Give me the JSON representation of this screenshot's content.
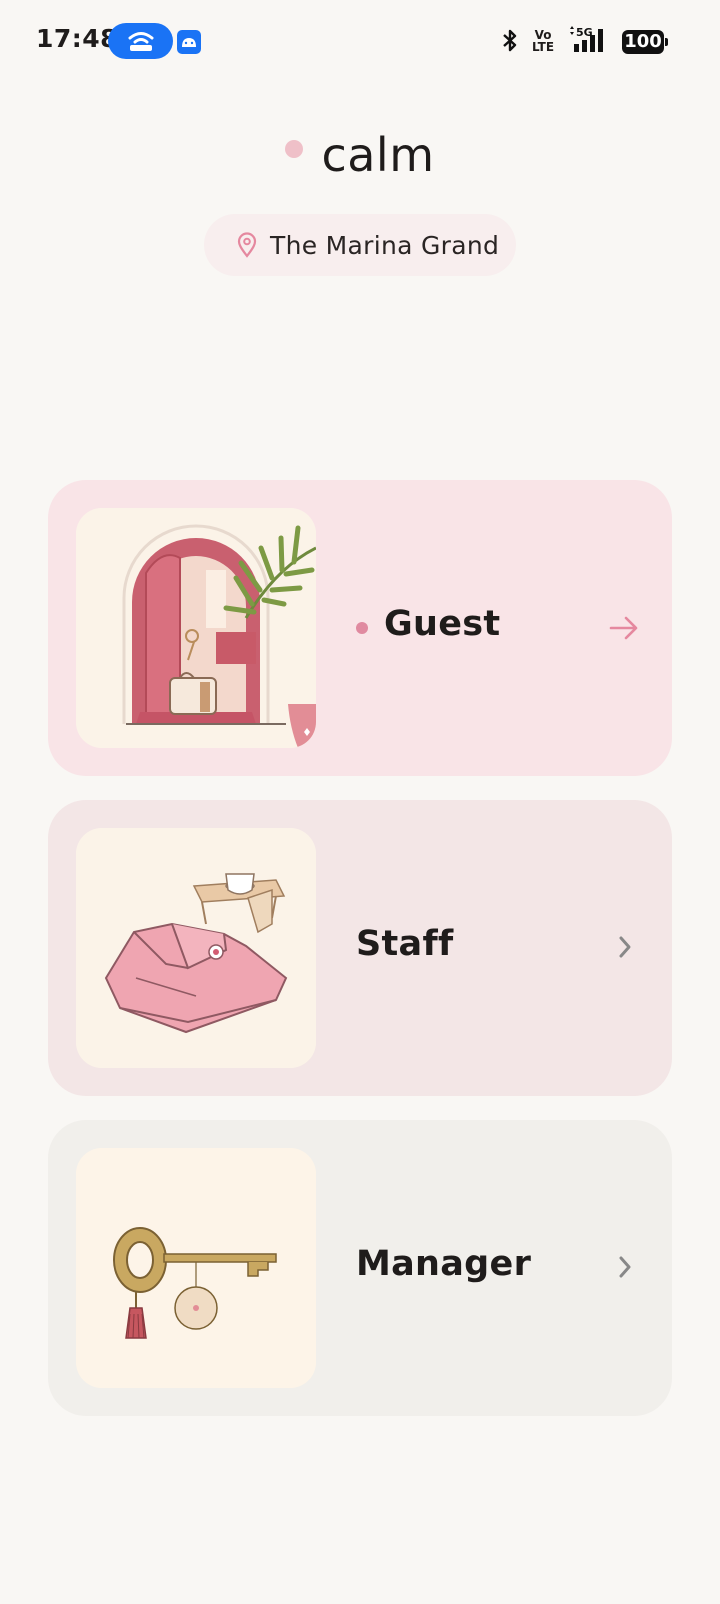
{
  "status_bar": {
    "time": "17:48",
    "volte_top": "Vo",
    "volte_bottom": "LTE",
    "network": "5G",
    "battery": "100"
  },
  "header": {
    "brand": "calm",
    "location": "The Marina Grand"
  },
  "roles": [
    {
      "label": "Guest"
    },
    {
      "label": "Staff"
    },
    {
      "label": "Manager"
    }
  ],
  "colors": {
    "accent_pink": "#e08aa0",
    "guest_card": "#f9e4e7",
    "staff_card": "#f3e6e6",
    "manager_card": "#f1efeb"
  }
}
